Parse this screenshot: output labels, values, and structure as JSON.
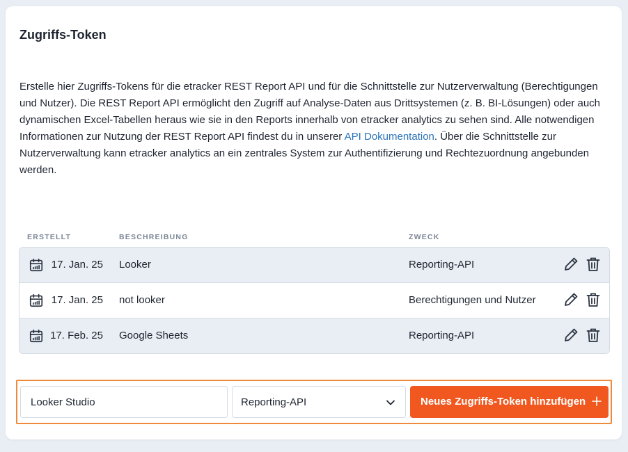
{
  "section": {
    "title": "Zugriffs-Token",
    "description_part1": "Erstelle hier Zugriffs-Tokens für die etracker REST Report API und für die Schnittstelle zur Nutzerverwaltung (Berechtigungen und Nutzer). Die REST Report API ermöglicht den Zugriff auf Analyse-Daten aus Drittsystemen (z. B. BI-Lösungen) oder auch dynamischen Excel-Tabellen heraus wie sie in den Reports innerhalb von etracker analytics zu sehen sind. Alle notwendigen Informationen zur Nutzung der REST Report API findest du in unserer ",
    "description_link": "API Dokumentation",
    "description_part2": ". Über die Schnittstelle zur Nutzerverwaltung kann etracker analytics an ein zentrales System zur Authentifizierung und Rechtezuordnung angebunden werden."
  },
  "table": {
    "headers": {
      "created": "ERSTELLT",
      "description": "BESCHREIBUNG",
      "purpose": "ZWECK"
    },
    "rows": [
      {
        "date": "17. Jan. 25",
        "description": "Looker",
        "purpose": "Reporting-API"
      },
      {
        "date": "17. Jan. 25",
        "description": "not looker",
        "purpose": "Berechtigungen und Nutzer"
      },
      {
        "date": "17. Feb. 25",
        "description": "Google Sheets",
        "purpose": "Reporting-API"
      }
    ]
  },
  "form": {
    "input_value": "Looker Studio",
    "select_value": "Reporting-API",
    "add_button_label": "Neues Zugriffs-Token hinzufügen"
  },
  "icons": {
    "row_icon": "calendar-icon",
    "edit": "pencil-icon",
    "delete": "trash-icon",
    "select": "chevron-down-icon",
    "add": "plus-icon"
  },
  "colors": {
    "accent": "#f0581f",
    "focus_border": "#ef8a3c",
    "link": "#2b74b8",
    "row_shade": "#e9eef4"
  }
}
